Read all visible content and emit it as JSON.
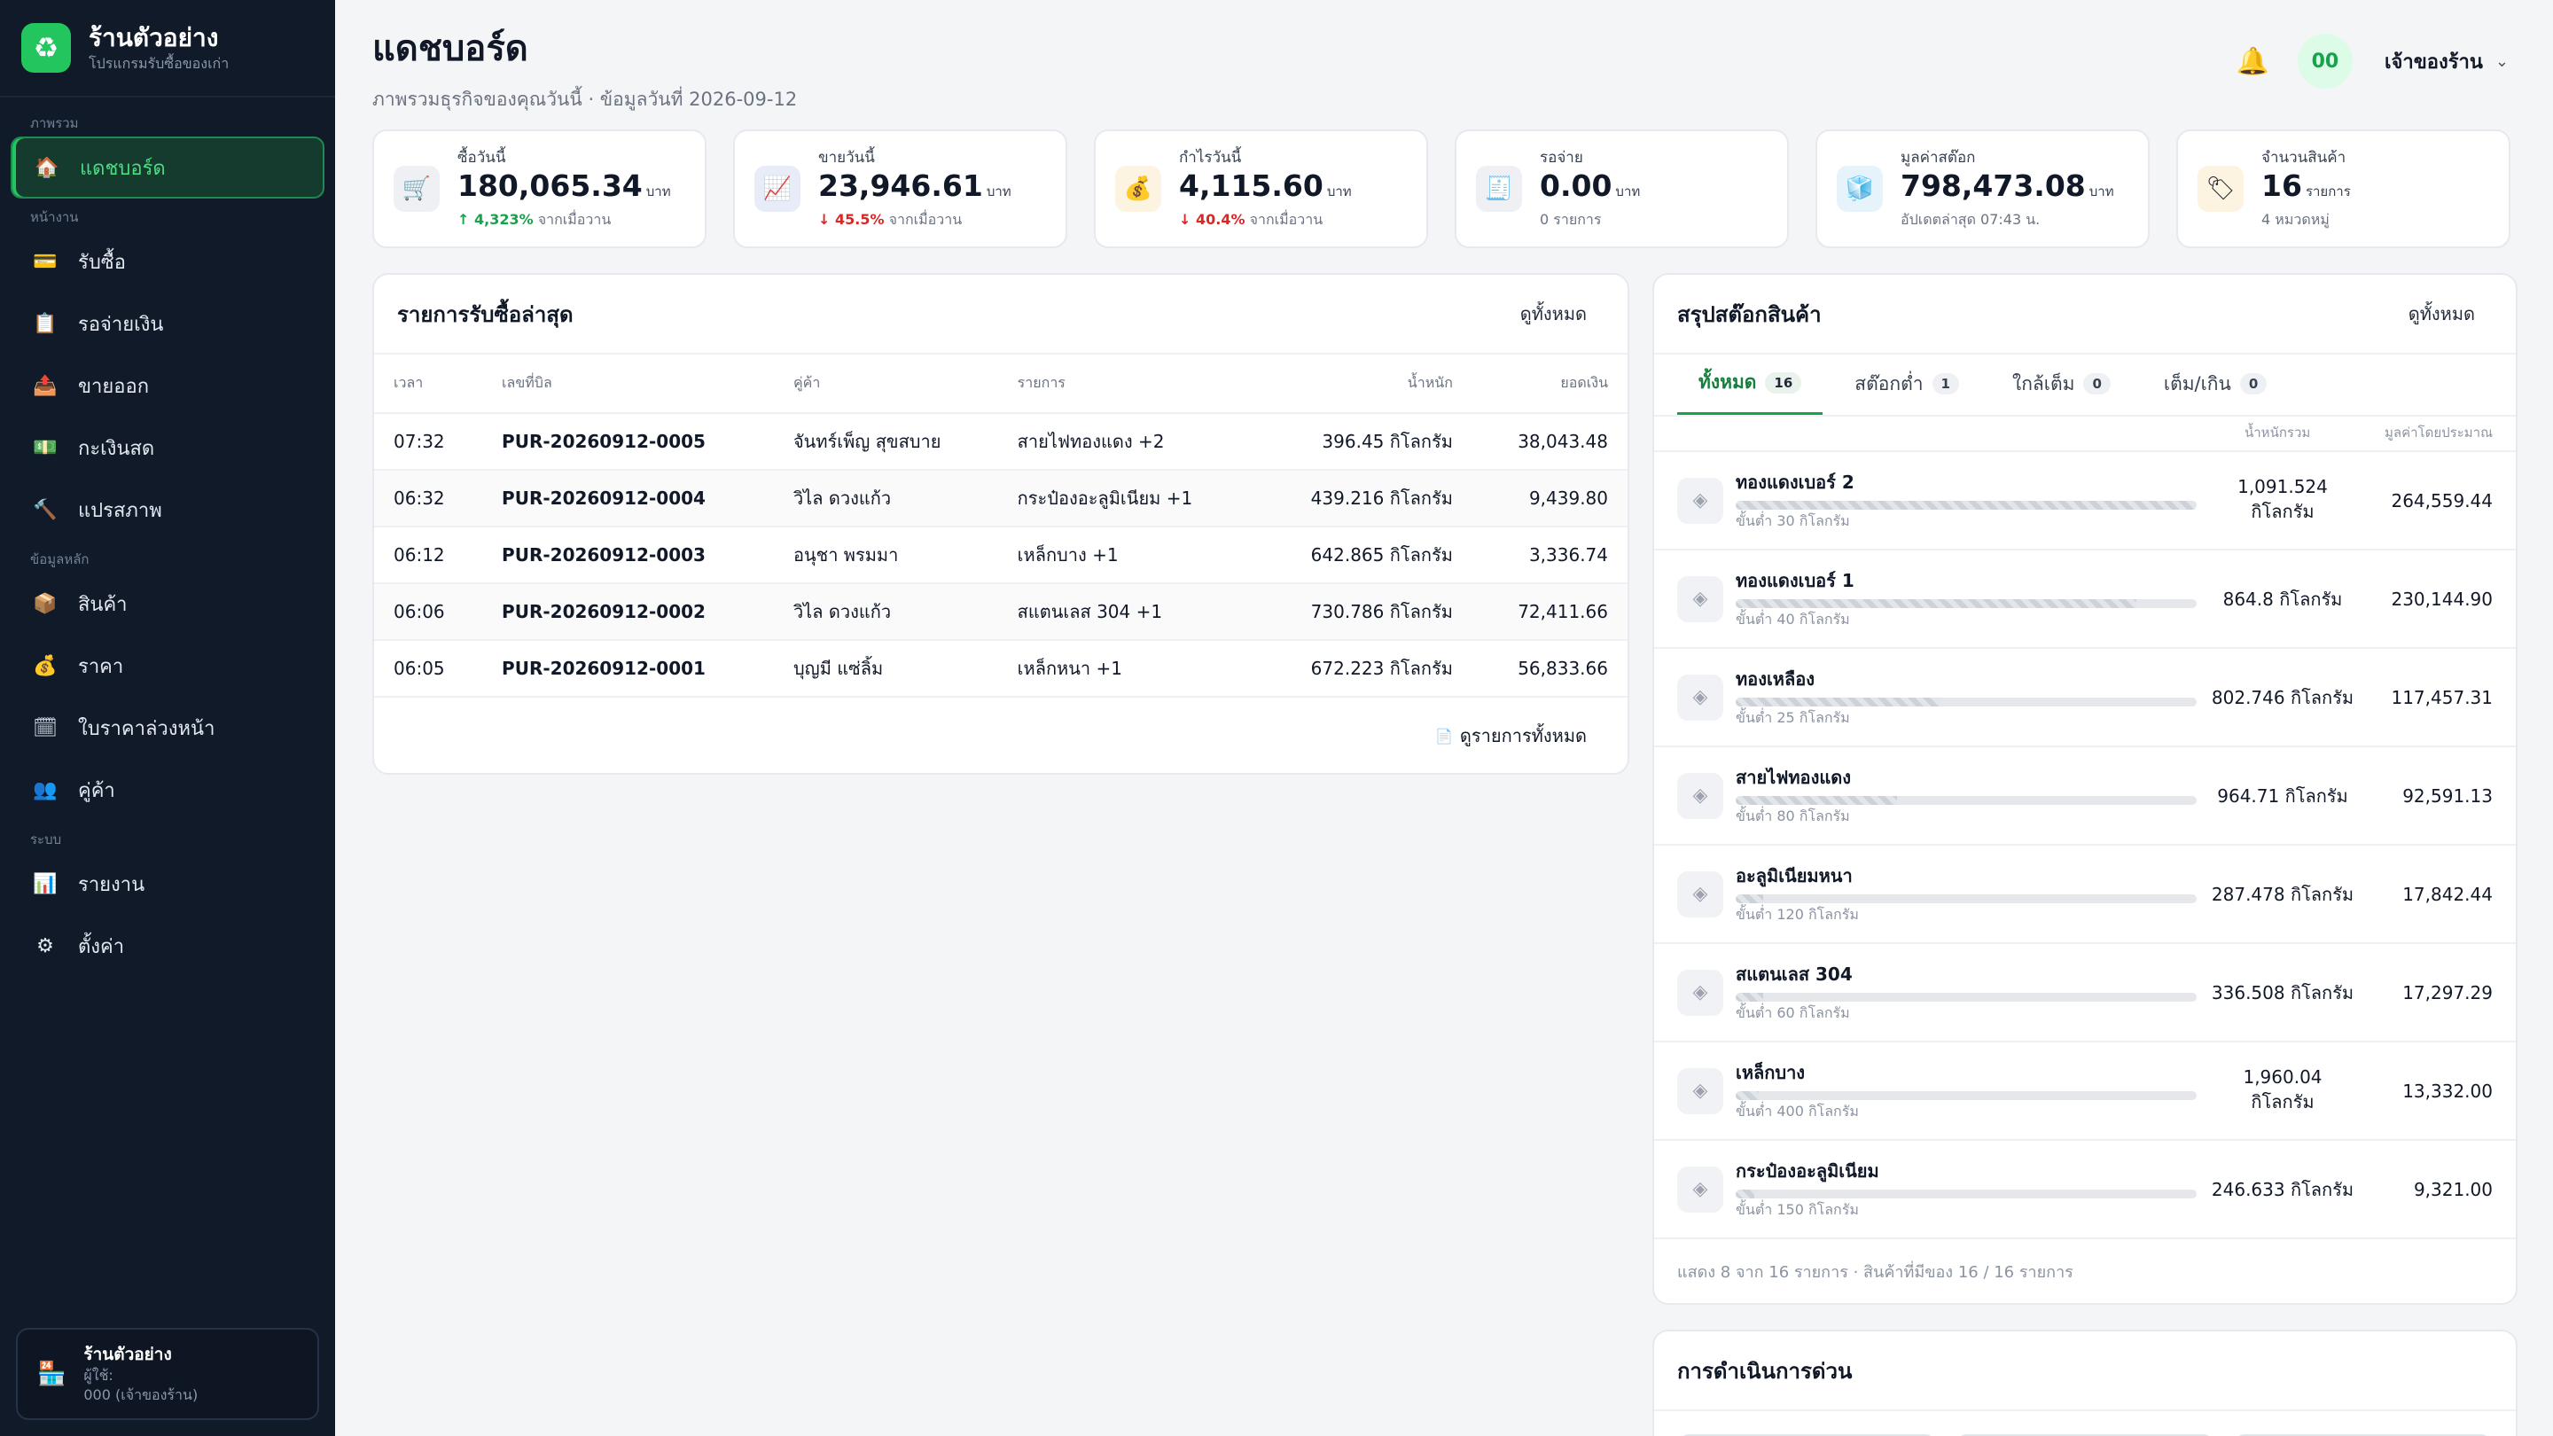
{
  "brand": {
    "icon": "♻",
    "name": "ร้านตัวอย่าง",
    "subtitle": "โปรแกรมรับซื้อของเก่า"
  },
  "sidebar": {
    "sections": [
      {
        "title": "ภาพรวม",
        "items": [
          {
            "icon": "🏠",
            "label": "แดชบอร์ด",
            "active": true
          }
        ]
      },
      {
        "title": "หน้างาน",
        "items": [
          {
            "icon": "💳",
            "label": "รับซื้อ"
          },
          {
            "icon": "📋",
            "label": "รอจ่ายเงิน"
          },
          {
            "icon": "📤",
            "label": "ขายออก"
          },
          {
            "icon": "💵",
            "label": "กะเงินสด"
          },
          {
            "icon": "🔨",
            "label": "แปรสภาพ"
          }
        ]
      },
      {
        "title": "ข้อมูลหลัก",
        "items": [
          {
            "icon": "📦",
            "label": "สินค้า"
          },
          {
            "icon": "💰",
            "label": "ราคา"
          },
          {
            "icon": "🗓",
            "label": "ใบราคาล่วงหน้า"
          },
          {
            "icon": "👥",
            "label": "คู่ค้า"
          }
        ]
      },
      {
        "title": "ระบบ",
        "items": [
          {
            "icon": "📊",
            "label": "รายงาน"
          },
          {
            "icon": "⚙",
            "label": "ตั้งค่า"
          }
        ]
      }
    ],
    "store_card": {
      "icon": "🏪",
      "name": "ร้านตัวอย่าง",
      "user_label": "ผู้ใช้:",
      "user": "000 (เจ้าของร้าน)"
    }
  },
  "header": {
    "title": "แดชบอร์ด",
    "subtitle": "ภาพรวมธุรกิจของคุณวันนี้ · ข้อมูลวันที่ 2026-09-12",
    "avatar": "00",
    "user": "เจ้าของร้าน",
    "chevron": "⌄",
    "bell": "🔔"
  },
  "stats": [
    {
      "icon": "🛒",
      "bg": "#eef0f4",
      "label": "ซื้อวันนี้",
      "value": "180,065.34",
      "unit": "บาท",
      "change": "↑ 4,323%",
      "change_dir": "up",
      "note": "จากเมื่อวาน"
    },
    {
      "icon": "📈",
      "bg": "#e8ecf8",
      "label": "ขายวันนี้",
      "value": "23,946.61",
      "unit": "บาท",
      "change": "↓ 45.5%",
      "change_dir": "down",
      "note": "จากเมื่อวาน"
    },
    {
      "icon": "💰",
      "bg": "#fdf3e1",
      "label": "กำไรวันนี้",
      "value": "4,115.60",
      "unit": "บาท",
      "change": "↓ 40.4%",
      "change_dir": "down",
      "note": "จากเมื่อวาน"
    },
    {
      "icon": "🧾",
      "bg": "#eef0f4",
      "label": "รอจ่าย",
      "value": "0.00",
      "unit": "บาท",
      "change": "",
      "change_dir": "",
      "note": "0 รายการ"
    },
    {
      "icon": "🧊",
      "bg": "#e6f3fb",
      "label": "มูลค่าสต๊อก",
      "value": "798,473.08",
      "unit": "บาท",
      "change": "",
      "change_dir": "",
      "note": "อัปเดตล่าสุด 07:43 น."
    },
    {
      "icon": "🏷",
      "bg": "#fdf3e1",
      "label": "จำนวนสินค้า",
      "value": "16",
      "unit": "รายการ",
      "change": "",
      "change_dir": "",
      "note": "4 หมวดหมู่"
    }
  ],
  "purchases": {
    "title": "รายการรับซื้อล่าสุด",
    "view_all": "ดูทั้งหมด",
    "columns": [
      "เวลา",
      "เลขที่บิล",
      "คู่ค้า",
      "รายการ",
      "น้ำหนัก",
      "ยอดเงิน"
    ],
    "rows": [
      [
        "07:32",
        "PUR-20260912-0005",
        "จันทร์เพ็ญ สุขสบาย",
        "สายไฟทองแดง +2",
        "396.45 กิโลกรัม",
        "38,043.48"
      ],
      [
        "06:32",
        "PUR-20260912-0004",
        "วิไล ดวงแก้ว",
        "กระป๋องอะลูมิเนียม +1",
        "439.216 กิโลกรัม",
        "9,439.80"
      ],
      [
        "06:12",
        "PUR-20260912-0003",
        "อนุชา พรมมา",
        "เหล็กบาง +1",
        "642.865 กิโลกรัม",
        "3,336.74"
      ],
      [
        "06:06",
        "PUR-20260912-0002",
        "วิไล ดวงแก้ว",
        "สแตนเลส 304 +1",
        "730.786 กิโลกรัม",
        "72,411.66"
      ],
      [
        "06:05",
        "PUR-20260912-0001",
        "บุญมี แซ่ลิ้ม",
        "เหล็กหนา +1",
        "672.223 กิโลกรัม",
        "56,833.66"
      ]
    ],
    "footer_icon": "📄",
    "footer": "ดูรายการทั้งหมด"
  },
  "stock": {
    "title": "สรุปสต๊อกสินค้า",
    "view_all": "ดูทั้งหมด",
    "tabs": [
      {
        "label": "ทั้งหมด",
        "count": "16",
        "active": true
      },
      {
        "label": "สต๊อกต่ำ",
        "count": "1"
      },
      {
        "label": "ใกล้เต็ม",
        "count": "0"
      },
      {
        "label": "เต็ม/เกิน",
        "count": "0"
      }
    ],
    "col_weight": "น้ำหนักรวม",
    "col_value": "มูลค่าโดยประมาณ",
    "items": [
      {
        "name": "ทองแดงเบอร์ 2",
        "min": "ขั้นต่ำ 30 กิโลกรัม",
        "weight": "1,091.524 กิโลกรัม",
        "value": "264,559.44",
        "level": 1.0
      },
      {
        "name": "ทองแดงเบอร์ 1",
        "min": "ขั้นต่ำ 40 กิโลกรัม",
        "weight": "864.8 กิโลกรัม",
        "value": "230,144.90",
        "level": 0.87
      },
      {
        "name": "ทองเหลือง",
        "min": "ขั้นต่ำ 25 กิโลกรัม",
        "weight": "802.746 กิโลกรัม",
        "value": "117,457.31",
        "level": 0.44
      },
      {
        "name": "สายไฟทองแดง",
        "min": "ขั้นต่ำ 80 กิโลกรัม",
        "weight": "964.71 กิโลกรัม",
        "value": "92,591.13",
        "level": 0.35
      },
      {
        "name": "อะลูมิเนียมหนา",
        "min": "ขั้นต่ำ 120 กิโลกรัม",
        "weight": "287.478 กิโลกรัม",
        "value": "17,842.44",
        "level": 0.06
      },
      {
        "name": "สแตนเลส 304",
        "min": "ขั้นต่ำ 60 กิโลกรัม",
        "weight": "336.508 กิโลกรัม",
        "value": "17,297.29",
        "level": 0.06
      },
      {
        "name": "เหล็กบาง",
        "min": "ขั้นต่ำ 400 กิโลกรัม",
        "weight": "1,960.04 กิโลกรัม",
        "value": "13,332.00",
        "level": 0.05
      },
      {
        "name": "กระป๋องอะลูมิเนียม",
        "min": "ขั้นต่ำ 150 กิโลกรัม",
        "weight": "246.633 กิโลกรัม",
        "value": "9,321.00",
        "level": 0.04
      }
    ],
    "footer": "แสดง 8 จาก 16 รายการ · สินค้าที่มีของ 16 / 16 รายการ"
  },
  "quick_actions": {
    "title": "การดำเนินการด่วน"
  }
}
